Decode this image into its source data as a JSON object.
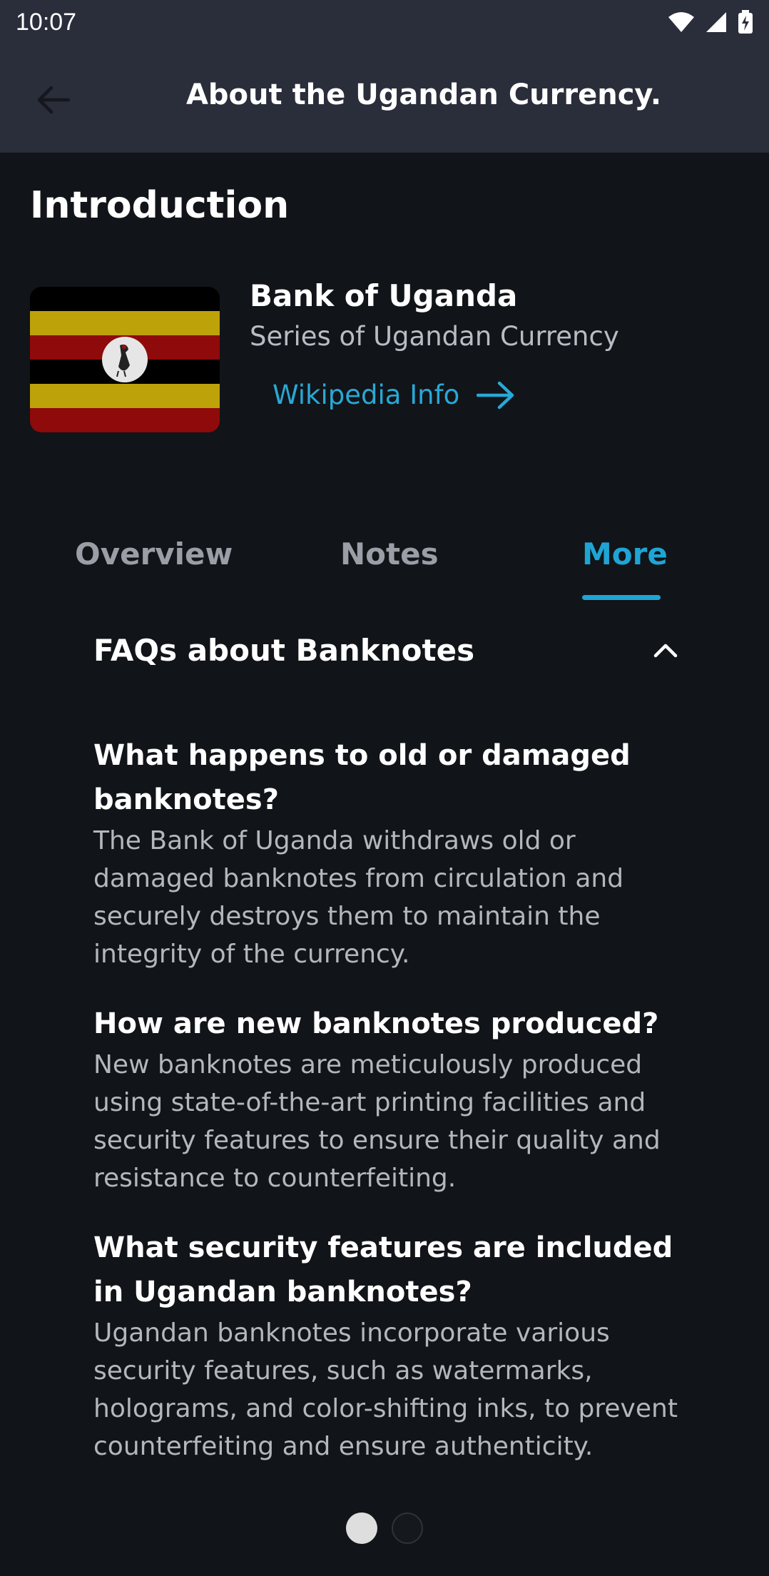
{
  "status_bar": {
    "time": "10:07"
  },
  "app_bar": {
    "title": "About the Ugandan Currency."
  },
  "section": {
    "title": "Introduction"
  },
  "bank": {
    "name": "Bank of Uganda",
    "subtitle": "Series of Ugandan Currency",
    "wiki_label": "Wikipedia Info"
  },
  "tabs": [
    {
      "label": "Overview",
      "active": false
    },
    {
      "label": "Notes",
      "active": false
    },
    {
      "label": "More",
      "active": true
    }
  ],
  "faq": {
    "header": "FAQs about Banknotes",
    "items": [
      {
        "question": "What happens to old or damaged banknotes?",
        "answer": "The Bank of Uganda withdraws old or damaged banknotes from circulation and securely destroys them to maintain the integrity of the currency."
      },
      {
        "question": "How are new banknotes produced?",
        "answer": "New banknotes are meticulously produced using state-of-the-art printing facilities and security features to ensure their quality and resistance to counterfeiting."
      },
      {
        "question": "What security features are included in Ugandan banknotes?",
        "answer": "Ugandan banknotes incorporate various security features, such as watermarks, holograms, and color-shifting inks, to prevent counterfeiting and ensure authenticity."
      }
    ]
  },
  "pager": {
    "pages": 2,
    "current": 1
  },
  "colors": {
    "accent": "#1ea5d6",
    "app_bar": "#2a2d3a",
    "background": "#111418"
  },
  "icons": [
    "wifi-icon",
    "signal-icon",
    "battery-charging-icon",
    "back-arrow-icon",
    "arrow-right-icon",
    "chevron-up-icon"
  ]
}
